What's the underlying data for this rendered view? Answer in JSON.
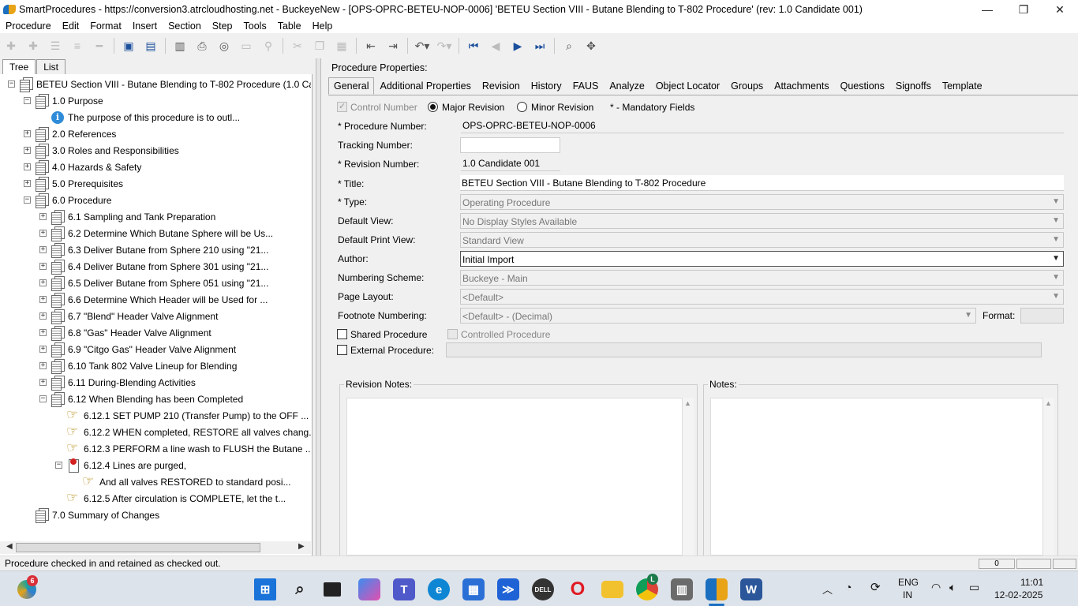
{
  "window": {
    "title": "SmartProcedures - https://conversion3.atrcloudhosting.net - BuckeyeNew - [OPS-OPRC-BETEU-NOP-0006] 'BETEU Section VIII - Butane Blending to T-802 Procedure' (rev: 1.0 Candidate 001)",
    "minimize": "—",
    "restore": "❐",
    "close": "✕"
  },
  "menu": [
    "Procedure",
    "Edit",
    "Format",
    "Insert",
    "Section",
    "Step",
    "Tools",
    "Table",
    "Help"
  ],
  "left_tabs": [
    "Tree",
    "List"
  ],
  "tree": [
    {
      "label": "BETEU Section VIII - Butane Blending to T-802 Procedure (1.0 Ca...",
      "level": 0,
      "exp": "−",
      "icon": "doc"
    },
    {
      "label": "1.0 Purpose",
      "level": 1,
      "exp": "−",
      "icon": "doc"
    },
    {
      "label": "The purpose of this procedure is to outl...",
      "level": 2,
      "exp": "",
      "icon": "info"
    },
    {
      "label": "2.0 References",
      "level": 1,
      "exp": "+",
      "icon": "doc"
    },
    {
      "label": "3.0 Roles and Responsibilities",
      "level": 1,
      "exp": "+",
      "icon": "doc"
    },
    {
      "label": "4.0 Hazards & Safety",
      "level": 1,
      "exp": "+",
      "icon": "doc"
    },
    {
      "label": "5.0 Prerequisites",
      "level": 1,
      "exp": "+",
      "icon": "doc"
    },
    {
      "label": "6.0 Procedure",
      "level": 1,
      "exp": "−",
      "icon": "doc"
    },
    {
      "label": "6.1 Sampling and Tank Preparation",
      "level": 2,
      "exp": "+",
      "icon": "doc"
    },
    {
      "label": "6.2 Determine Which Butane Sphere will be Us...",
      "level": 2,
      "exp": "+",
      "icon": "doc"
    },
    {
      "label": "6.3 Deliver Butane from Sphere 210 using \"21...",
      "level": 2,
      "exp": "+",
      "icon": "doc"
    },
    {
      "label": "6.4 Deliver Butane from Sphere 301 using \"21...",
      "level": 2,
      "exp": "+",
      "icon": "doc"
    },
    {
      "label": "6.5 Deliver Butane from Sphere 051 using \"21...",
      "level": 2,
      "exp": "+",
      "icon": "doc"
    },
    {
      "label": "6.6 Determine Which Header will be Used for ...",
      "level": 2,
      "exp": "+",
      "icon": "doc"
    },
    {
      "label": "6.7 \"Blend\" Header Valve Alignment",
      "level": 2,
      "exp": "+",
      "icon": "doc"
    },
    {
      "label": "6.8 \"Gas\" Header Valve Alignment",
      "level": 2,
      "exp": "+",
      "icon": "doc"
    },
    {
      "label": "6.9 \"Citgo Gas\" Header Valve Alignment",
      "level": 2,
      "exp": "+",
      "icon": "doc"
    },
    {
      "label": "6.10 Tank 802 Valve Lineup for Blending",
      "level": 2,
      "exp": "+",
      "icon": "doc"
    },
    {
      "label": "6.11 During-Blending Activities",
      "level": 2,
      "exp": "+",
      "icon": "doc"
    },
    {
      "label": "6.12 When Blending has been Completed",
      "level": 2,
      "exp": "−",
      "icon": "doc"
    },
    {
      "label": "6.12.1 SET PUMP 210 (Transfer Pump) to the OFF ...",
      "level": 3,
      "exp": "",
      "icon": "hand"
    },
    {
      "label": "6.12.2 WHEN completed, RESTORE all valves chang...",
      "level": 3,
      "exp": "",
      "icon": "hand"
    },
    {
      "label": "6.12.3 PERFORM a line wash to FLUSH the Butane ...",
      "level": 3,
      "exp": "",
      "icon": "hand"
    },
    {
      "label": "6.12.4 Lines are purged,",
      "level": 3,
      "exp": "−",
      "icon": "warn"
    },
    {
      "label": "And all valves RESTORED to standard posi...",
      "level": 4,
      "exp": "",
      "icon": "hand"
    },
    {
      "label": "6.12.5 After circulation is COMPLETE, let the t...",
      "level": 3,
      "exp": "",
      "icon": "hand"
    },
    {
      "label": "7.0 Summary of Changes",
      "level": 1,
      "exp": "",
      "icon": "doc"
    }
  ],
  "props": {
    "heading": "Procedure Properties:",
    "tabs": [
      "General",
      "Additional Properties",
      "Revision",
      "History",
      "FAUS",
      "Analyze",
      "Object Locator",
      "Groups",
      "Attachments",
      "Questions",
      "Signoffs",
      "Template"
    ],
    "control_number": "Control Number",
    "major_revision": "Major Revision",
    "minor_revision": "Minor Revision",
    "mandatory": "* - Mandatory Fields",
    "procedure_number_label": "* Procedure Number:",
    "procedure_number": "OPS-OPRC-BETEU-NOP-0006",
    "tracking_number_label": "Tracking Number:",
    "tracking_number": "",
    "revision_number_label": "* Revision Number:",
    "revision_number": "1.0 Candidate 001",
    "title_label": "* Title:",
    "title": "BETEU Section VIII - Butane Blending to T-802 Procedure",
    "type_label": "* Type:",
    "type": "Operating Procedure",
    "default_view_label": "Default View:",
    "default_view": "No Display Styles Available",
    "default_print_view_label": "Default Print View:",
    "default_print_view": "Standard View",
    "author_label": "Author:",
    "author": "Initial Import",
    "numbering_scheme_label": "Numbering Scheme:",
    "numbering_scheme": "Buckeye - Main",
    "page_layout_label": "Page Layout:",
    "page_layout": "<Default>",
    "footnote_label": "Footnote Numbering:",
    "footnote": "<Default> - (Decimal)",
    "format_label": "Format:",
    "shared_procedure": "Shared Procedure",
    "controlled_procedure": "Controlled Procedure",
    "external_procedure": "External Procedure:",
    "revision_notes": "Revision Notes:",
    "notes": "Notes:"
  },
  "status": {
    "text": "Procedure checked in and retained as checked out.",
    "cell1": "0",
    "cell2": "",
    "cell3": ""
  },
  "taskbar": {
    "notif_badge": "6",
    "chrome_badge": "L",
    "lang1": "ENG",
    "lang2": "IN",
    "time": "11:01",
    "date": "12-02-2025"
  }
}
